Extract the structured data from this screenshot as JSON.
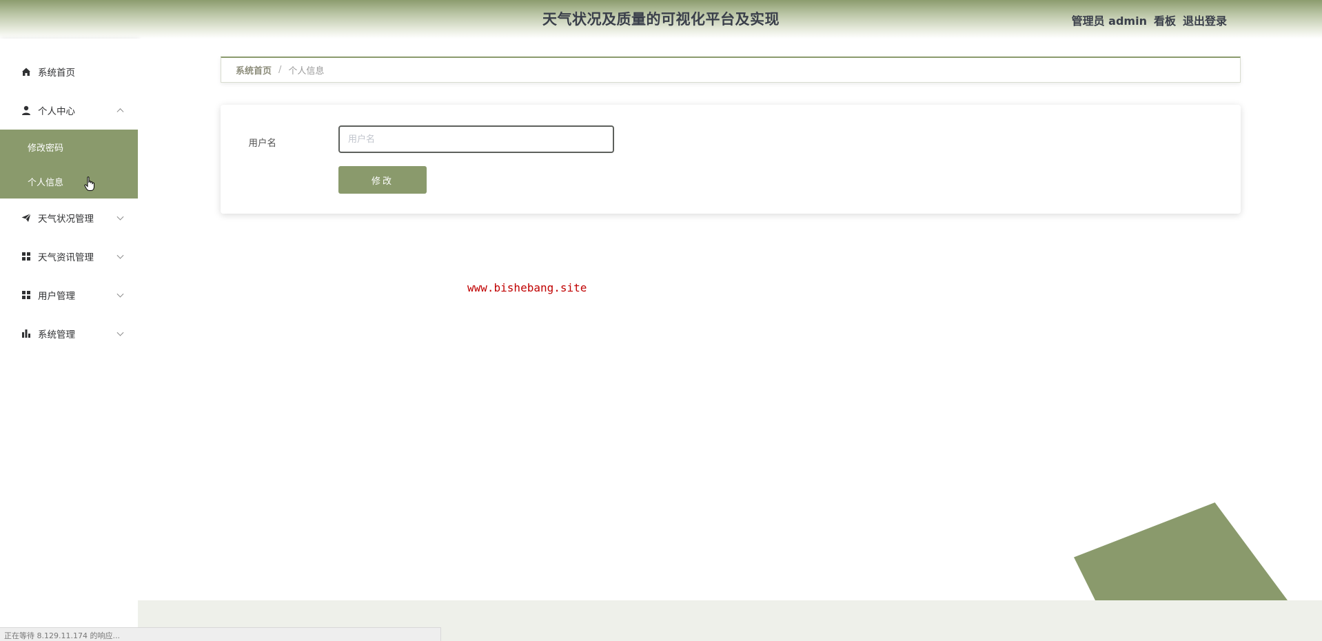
{
  "header": {
    "title": "天气状况及质量的可视化平台及实现",
    "user_label": "管理员 admin",
    "dashboard_label": "看板",
    "logout_label": "退出登录"
  },
  "sidebar": {
    "items": [
      {
        "label": "系统首页",
        "icon": "home-icon"
      },
      {
        "label": "个人中心",
        "icon": "user-icon",
        "expanded": true,
        "children": [
          {
            "label": "修改密码"
          },
          {
            "label": "个人信息"
          }
        ]
      },
      {
        "label": "天气状况管理",
        "icon": "send-icon"
      },
      {
        "label": "天气资讯管理",
        "icon": "grid-icon"
      },
      {
        "label": "用户管理",
        "icon": "grid-icon"
      },
      {
        "label": "系统管理",
        "icon": "bar-chart-icon"
      }
    ]
  },
  "breadcrumb": {
    "home": "系统首页",
    "separator": "/",
    "current": "个人信息"
  },
  "form": {
    "username_label": "用户名",
    "username_value": "",
    "username_placeholder": "用户名",
    "submit_label": "修改"
  },
  "watermark": "www.bishebang.site",
  "status_bar": "正在等待 8.129.11.174 的响应...",
  "colors": {
    "accent": "#8a9a6c",
    "header_text": "#3a3f4a",
    "watermark": "#c00000"
  }
}
